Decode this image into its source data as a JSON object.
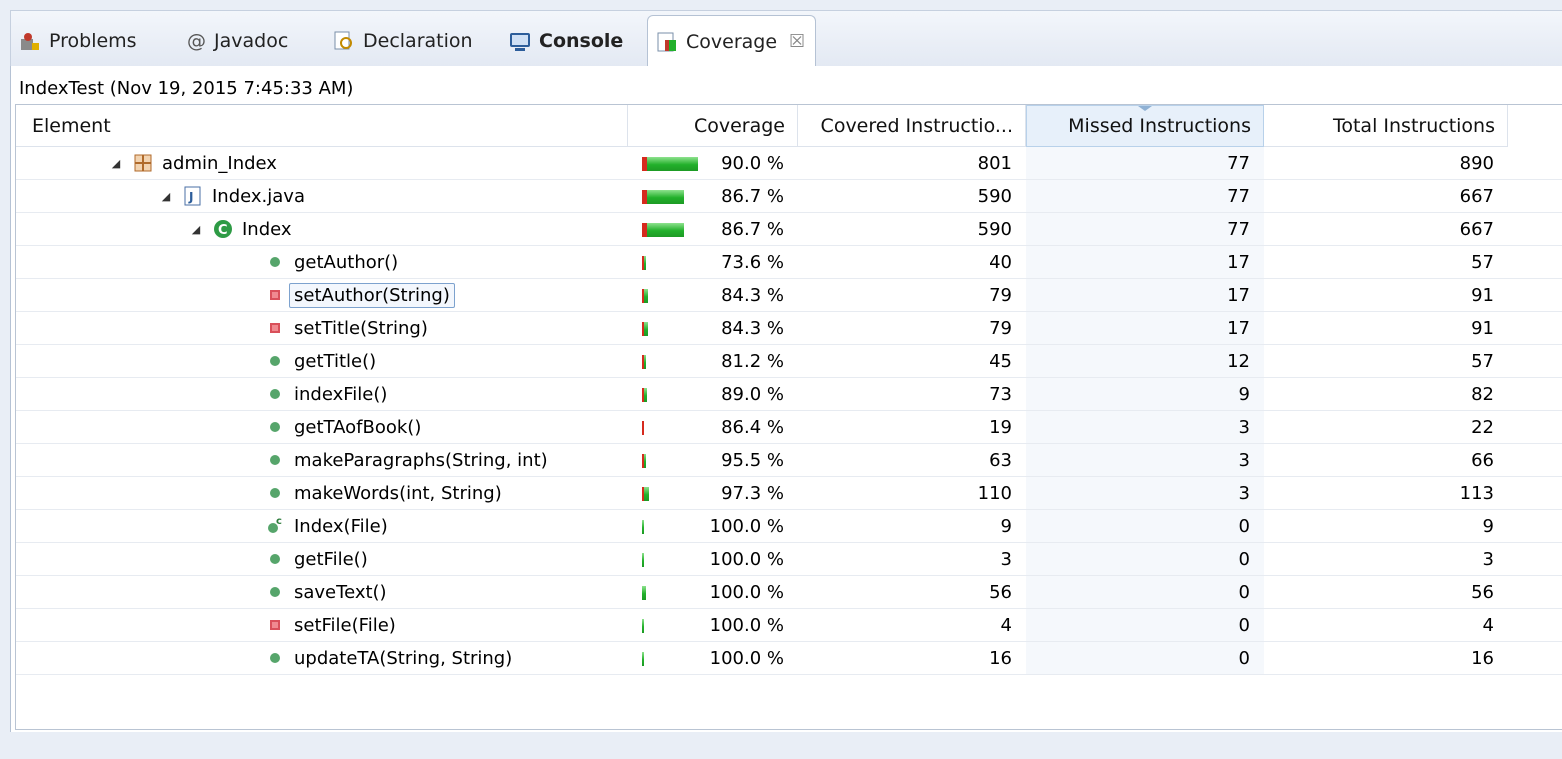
{
  "tabs": [
    {
      "label": "Problems",
      "icon": "problems-icon",
      "active": false,
      "bold": false
    },
    {
      "label": "Javadoc",
      "icon": "at-icon",
      "active": false,
      "bold": false
    },
    {
      "label": "Declaration",
      "icon": "declaration-icon",
      "active": false,
      "bold": false
    },
    {
      "label": "Console",
      "icon": "console-icon",
      "active": false,
      "bold": true
    },
    {
      "label": "Coverage",
      "icon": "coverage-icon",
      "active": true,
      "bold": false
    }
  ],
  "close_glyph": "☒",
  "session_title": "IndexTest (Nov 19, 2015 7:45:33 AM)",
  "columns": {
    "element": "Element",
    "coverage": "Coverage",
    "covered": "Covered Instructio...",
    "missed": "Missed Instructions",
    "total": "Total Instructions"
  },
  "colors": {
    "covered": "#22b02b",
    "missed": "#d62a1e",
    "selection": "#7da2ce"
  },
  "rows": [
    {
      "name": "admin_Index",
      "icon": "package-icon",
      "depth": 0,
      "expanded": true,
      "coverage_pct": 90.0,
      "coverage": "90.0 %",
      "covered": "801",
      "missed": "77",
      "total": "890"
    },
    {
      "name": "Index.java",
      "icon": "java-file-icon",
      "depth": 1,
      "expanded": true,
      "coverage_pct": 86.7,
      "coverage": "86.7 %",
      "covered": "590",
      "missed": "77",
      "total": "667"
    },
    {
      "name": "Index",
      "icon": "class-icon",
      "depth": 2,
      "expanded": true,
      "coverage_pct": 86.7,
      "coverage": "86.7 %",
      "covered": "590",
      "missed": "77",
      "total": "667"
    },
    {
      "name": "getAuthor()",
      "icon": "public-method-icon",
      "depth": 3,
      "coverage_pct": 73.6,
      "coverage": "73.6 %",
      "covered": "40",
      "missed": "17",
      "total": "57"
    },
    {
      "name": "setAuthor(String)",
      "icon": "private-method-icon",
      "depth": 3,
      "selected": true,
      "coverage_pct": 84.3,
      "coverage": "84.3 %",
      "covered": "79",
      "missed": "17",
      "total": "91"
    },
    {
      "name": "setTitle(String)",
      "icon": "private-method-icon",
      "depth": 3,
      "coverage_pct": 84.3,
      "coverage": "84.3 %",
      "covered": "79",
      "missed": "17",
      "total": "91"
    },
    {
      "name": "getTitle()",
      "icon": "public-method-icon",
      "depth": 3,
      "coverage_pct": 81.2,
      "coverage": "81.2 %",
      "covered": "45",
      "missed": "12",
      "total": "57"
    },
    {
      "name": "indexFile()",
      "icon": "public-method-icon",
      "depth": 3,
      "coverage_pct": 89.0,
      "coverage": "89.0 %",
      "covered": "73",
      "missed": "9",
      "total": "82"
    },
    {
      "name": "getTAofBook()",
      "icon": "public-method-icon",
      "depth": 3,
      "coverage_pct": 86.4,
      "coverage": "86.4 %",
      "covered": "19",
      "missed": "3",
      "total": "22"
    },
    {
      "name": "makeParagraphs(String, int)",
      "icon": "public-method-icon",
      "depth": 3,
      "coverage_pct": 95.5,
      "coverage": "95.5 %",
      "covered": "63",
      "missed": "3",
      "total": "66"
    },
    {
      "name": "makeWords(int, String)",
      "icon": "public-method-icon",
      "depth": 3,
      "coverage_pct": 97.3,
      "coverage": "97.3 %",
      "covered": "110",
      "missed": "3",
      "total": "113"
    },
    {
      "name": "Index(File)",
      "icon": "constructor-icon",
      "depth": 3,
      "coverage_pct": 100.0,
      "coverage": "100.0 %",
      "covered": "9",
      "missed": "0",
      "total": "9"
    },
    {
      "name": "getFile()",
      "icon": "public-method-icon",
      "depth": 3,
      "coverage_pct": 100.0,
      "coverage": "100.0 %",
      "covered": "3",
      "missed": "0",
      "total": "3"
    },
    {
      "name": "saveText()",
      "icon": "public-method-icon",
      "depth": 3,
      "coverage_pct": 100.0,
      "coverage": "100.0 %",
      "covered": "56",
      "missed": "0",
      "total": "56"
    },
    {
      "name": "setFile(File)",
      "icon": "private-method-icon",
      "depth": 3,
      "coverage_pct": 100.0,
      "coverage": "100.0 %",
      "covered": "4",
      "missed": "0",
      "total": "4"
    },
    {
      "name": "updateTA(String, String)",
      "icon": "public-method-icon",
      "depth": 3,
      "coverage_pct": 100.0,
      "coverage": "100.0 %",
      "covered": "16",
      "missed": "0",
      "total": "16"
    }
  ]
}
